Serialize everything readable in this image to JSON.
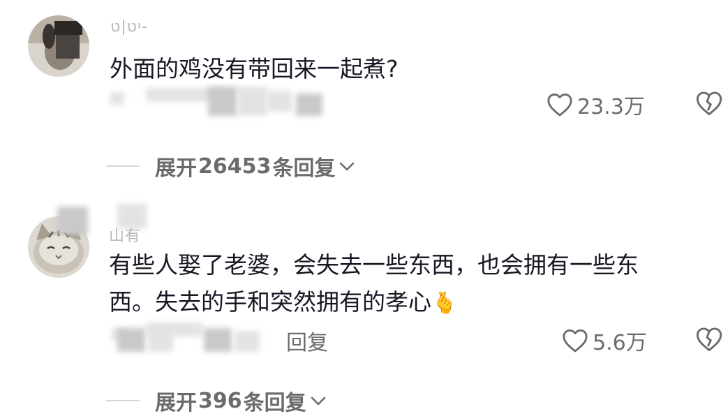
{
  "comments": [
    {
      "username": "יט|ט-",
      "text": "外面的鸡没有带回来一起煮?",
      "likes": "23.3万",
      "expand": {
        "prefix": "展开",
        "count": "26453",
        "suffix": "条回复"
      }
    },
    {
      "username": "山有",
      "text_line1": "有些人娶了老婆，会失去一些东西，也会拥有一些东",
      "text_line2": "西。失去的手和突然拥有的孝心",
      "emoji": "🫰",
      "reply_label": "回复",
      "likes": "5.6万",
      "expand": {
        "prefix": "展开",
        "count": "396",
        "suffix": "条回复"
      }
    }
  ],
  "icons": {
    "like": "heart-outline-icon",
    "dislike": "broken-heart-icon",
    "expand": "chevron-down-icon"
  },
  "colors": {
    "text": "#161823",
    "secondary": "#6b6b6b",
    "username": "#b8b8b8"
  }
}
